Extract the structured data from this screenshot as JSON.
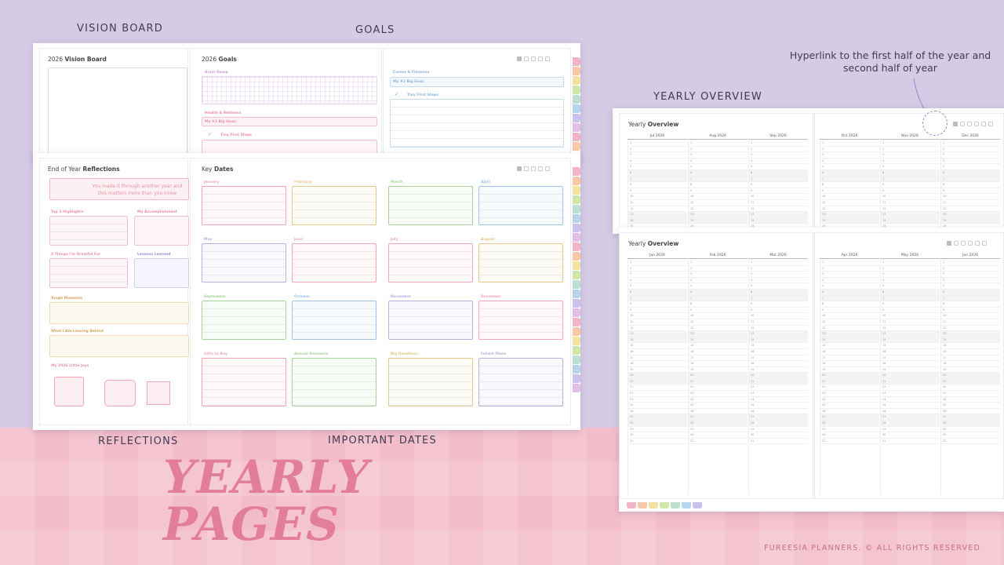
{
  "labels": {
    "vision_board": "VISION BOARD",
    "goals": "GOALS",
    "reflections": "REFLECTIONS",
    "important_dates": "IMPORTANT DATES",
    "yearly_overview": "YEARLY OVERVIEW",
    "hyperlink_note": "Hyperlink to the first half of the year and second half of year"
  },
  "headline": {
    "line1": "YEARLY",
    "line2": "PAGES"
  },
  "footer": "FUREESIA PLANNERS. © ALL RIGHTS RESERVED",
  "vision_board": {
    "title_prefix": "2026",
    "title_bold": "Vision Board"
  },
  "goals": {
    "title_prefix": "2026",
    "title_bold": "Goals",
    "brain_dump": "Brain Dump",
    "health": "Health & Wellness",
    "big_goal": "My #1 Big Goal:",
    "first_steps": "Tiny First Steps",
    "career": "Career & Finances",
    "big_goal_2": "My #1 Big Goal:",
    "first_steps_2": "Tiny First Steps"
  },
  "reflections": {
    "title_prefix": "End of Year",
    "title_bold": "Reflections",
    "banner": "You made it through another year and this matters more than you know",
    "top3": "Top 3 Highlights",
    "accomplishment": "My Accomplishment",
    "grateful": "3 Things I'm Grateful For",
    "lessons": "Lessons Learned",
    "tough": "Tough Moments",
    "leaving": "What I Am Leaving Behind",
    "joys": "My 2026 Little Joys"
  },
  "key_dates": {
    "title_prefix": "Key",
    "title_bold": "Dates",
    "months": [
      "January",
      "February",
      "March",
      "April",
      "May",
      "June",
      "July",
      "August",
      "September",
      "October",
      "November",
      "December"
    ],
    "extras": [
      "Gifts to Buy",
      "Annual Renewals",
      "Big Deadlines",
      "Future Plans"
    ],
    "colors": [
      "#f3a6b8",
      "#e6c98a",
      "#a6d49a",
      "#9fc4e8",
      "#b8b0e0",
      "#f3a6b8",
      "#f3a6b8",
      "#e6c98a",
      "#a6d49a",
      "#9fc4e8",
      "#b8b0e0",
      "#f3a6b8",
      "#f3a6b8",
      "#a6d49a",
      "#e6c98a",
      "#b8b0e0"
    ]
  },
  "overview_h2": {
    "title_prefix": "Yearly",
    "title_bold": "Overview",
    "months": [
      "Jul 2026",
      "Aug 2026",
      "Sep 2026",
      "Oct 2026",
      "Nov 2026",
      "Dec 2026"
    ]
  },
  "overview_h1": {
    "title_prefix": "Yearly",
    "title_bold": "Overview",
    "months": [
      "Jan 2026",
      "Feb 2026",
      "Mar 2026",
      "Apr 2026",
      "May 2026",
      "Jun 2026"
    ]
  },
  "tab_colors": [
    "#f3b5c4",
    "#f7c9a8",
    "#f4e1a1",
    "#cfe6a8",
    "#b9e0cf",
    "#b7d4ef",
    "#c9c2ee",
    "#e2bfe8",
    "#f3b5c4",
    "#f7c9a8",
    "#f4e1a1",
    "#cfe6a8",
    "#b9e0cf",
    "#b7d4ef",
    "#c9c2ee",
    "#e2bfe8"
  ]
}
